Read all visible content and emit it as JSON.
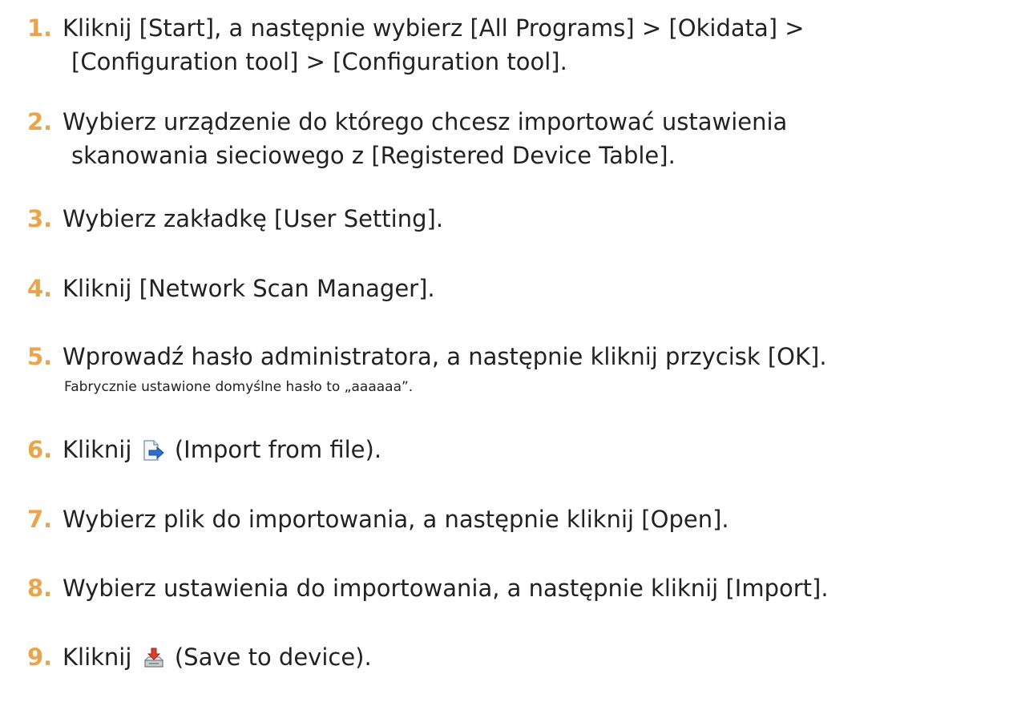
{
  "steps": [
    {
      "num": "1.",
      "line1": "Kliknij [Start], a następnie wybierz [All Programs] > [Okidata] >",
      "line2": "[Configuration tool] > [Configuration tool]."
    },
    {
      "num": "2.",
      "line1": "Wybierz urządzenie do którego chcesz importować ustawienia",
      "line2": "skanowania sieciowego z [Registered Device Table]."
    },
    {
      "num": "3.",
      "text": "Wybierz zakładkę [User Setting]."
    },
    {
      "num": "4.",
      "text": "Kliknij [Network Scan Manager]."
    },
    {
      "num": "5.",
      "text": "Wprowadź hasło administratora, a następnie kliknij przycisk [OK].",
      "note": "Fabrycznie ustawione domyślne hasło to „aaaaaa”."
    },
    {
      "num": "6.",
      "before": "Kliknij",
      "after": "(Import from file).",
      "icon": "import-file-icon"
    },
    {
      "num": "7.",
      "text": "Wybierz plik do importowania, a następnie kliknij [Open]."
    },
    {
      "num": "8.",
      "text": "Wybierz ustawienia do importowania, a następnie kliknij [Import]."
    },
    {
      "num": "9.",
      "before": "Kliknij",
      "after": "(Save to device).",
      "icon": "save-to-device-icon"
    }
  ],
  "colors": {
    "step_number": "#e8a54b",
    "text": "#222222",
    "background": "#ffffff"
  }
}
